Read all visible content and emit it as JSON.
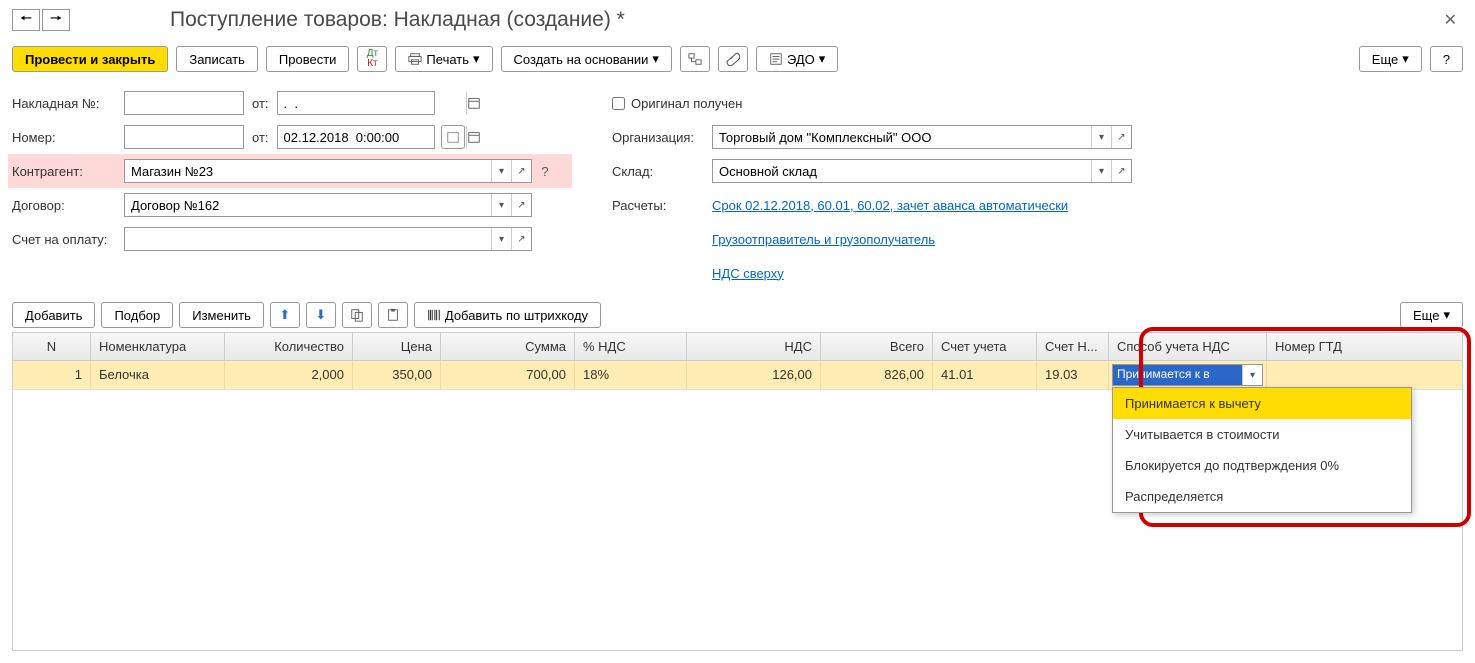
{
  "header": {
    "title": "Поступление товаров: Накладная (создание) *"
  },
  "toolbar": {
    "post_close": "Провести и закрыть",
    "save": "Записать",
    "post": "Провести",
    "print": "Печать",
    "create_based": "Создать на основании",
    "edo": "ЭДО",
    "more": "Еще",
    "help": "?"
  },
  "form": {
    "invoice_no_label": "Накладная №:",
    "invoice_no": "",
    "from_label": "от:",
    "invoice_date": ".  .",
    "number_label": "Номер:",
    "number": "",
    "doc_date": "02.12.2018  0:00:00",
    "kontragent_label": "Контрагент:",
    "kontragent": "Магазин №23",
    "dogovor_label": "Договор:",
    "dogovor": "Договор №162",
    "payacct_label": "Счет на оплату:",
    "payacct": "",
    "original_received": "Оригинал получен",
    "org_label": "Организация:",
    "org": "Торговый дом \"Комплексный\" ООО",
    "sklad_label": "Склад:",
    "sklad": "Основной склад",
    "raschety_label": "Расчеты:",
    "raschety_link": "Срок 02.12.2018, 60.01, 60.02, зачет аванса автоматически",
    "shipper_link": "Грузоотправитель и грузополучатель",
    "vat_link": "НДС сверху"
  },
  "table_toolbar": {
    "add": "Добавить",
    "pick": "Подбор",
    "edit": "Изменить",
    "barcode": "Добавить по штрихкоду",
    "more": "Еще"
  },
  "columns": {
    "n": "N",
    "nom": "Номенклатура",
    "qty": "Количество",
    "price": "Цена",
    "sum": "Сумма",
    "vatpct": "% НДС",
    "vat": "НДС",
    "total": "Всего",
    "acct": "Счет учета",
    "acctn": "Счет Н...",
    "vatmethod": "Способ учета НДС",
    "gtd": "Номер ГТД"
  },
  "rows": [
    {
      "n": "1",
      "nom": "Белочка",
      "qty": "2,000",
      "price": "350,00",
      "sum": "700,00",
      "vatpct": "18%",
      "vat": "126,00",
      "total": "826,00",
      "acct": "41.01",
      "acctn": "19.03",
      "vatmethod_sel": "Принимается к в"
    }
  ],
  "dropdown": {
    "items": [
      "Принимается к вычету",
      "Учитывается в стоимости",
      "Блокируется до подтверждения 0%",
      "Распределяется"
    ]
  }
}
